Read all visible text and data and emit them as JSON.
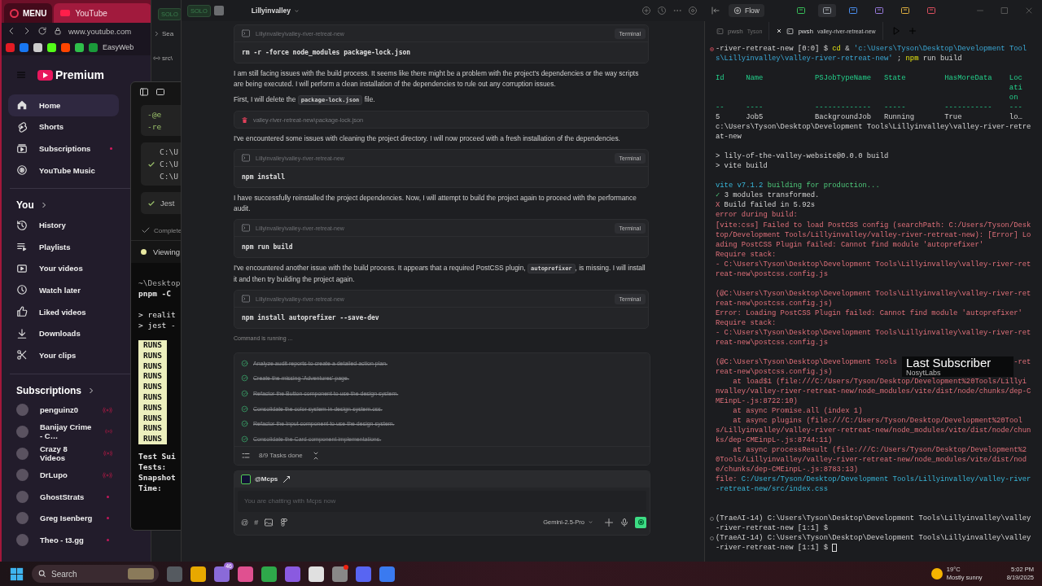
{
  "browser": {
    "menu_label": "MENU",
    "tab_title": "YouTube",
    "url": "www.youtube.com",
    "bookmark_label": "EasyWeb"
  },
  "youtube": {
    "logo_text": "Premium",
    "nav": [
      {
        "label": "Home",
        "selected": true,
        "dot": false
      },
      {
        "label": "Shorts",
        "selected": false,
        "dot": false
      },
      {
        "label": "Subscriptions",
        "selected": false,
        "dot": true
      },
      {
        "label": "YouTube Music",
        "selected": false,
        "dot": false
      }
    ],
    "you_heading": "You",
    "you_items": [
      {
        "label": "History"
      },
      {
        "label": "Playlists"
      },
      {
        "label": "Your videos"
      },
      {
        "label": "Watch later"
      },
      {
        "label": "Liked videos"
      },
      {
        "label": "Downloads"
      },
      {
        "label": "Your clips"
      }
    ],
    "subscriptions_heading": "Subscriptions",
    "channels": [
      {
        "name": "penguinz0",
        "kind": "live"
      },
      {
        "name": "Banijay Crime - C…",
        "kind": "live"
      },
      {
        "name": "Crazy 8 Videos",
        "kind": "live"
      },
      {
        "name": "DrLupo",
        "kind": "live"
      },
      {
        "name": "GhostStrats",
        "kind": "dot"
      },
      {
        "name": "Greg Isenberg",
        "kind": "dot"
      },
      {
        "name": "Theo - t3.gg",
        "kind": "dot"
      }
    ]
  },
  "jest_window": {
    "code_lines": [
      "-@e",
      "-re"
    ],
    "paths": [
      {
        "text": "C:\\U",
        "checked": false
      },
      {
        "text": "C:\\U",
        "checked": true
      },
      {
        "text": "C:\\U",
        "checked": false
      }
    ],
    "status_label": "Jest",
    "completed_label": "Complete",
    "viewing_label": "Viewing",
    "terminal_head": [
      "~\\Desktop",
      "pnpm -C"
    ],
    "terminal_cmds": [
      "> realit",
      "> jest -"
    ],
    "runs": [
      "RUNS",
      "RUNS",
      "RUNS",
      "RUNS",
      "RUNS",
      "RUNS",
      "RUNS",
      "RUNS",
      "RUNS",
      "RUNS"
    ],
    "summary": [
      "Test Sui",
      "Tests:",
      "Snapshot",
      "Time:"
    ]
  },
  "ide_back": {
    "solo_label": "SOLO",
    "rows": [
      "Sea",
      "src\\"
    ]
  },
  "ide": {
    "solo_label": "SOLO",
    "workspace": "Lillyinvalley",
    "messages": [
      {
        "kind": "command",
        "path": "Lillyinvalley\\valley-river-retreat-new",
        "label": "Terminal",
        "command": "rm -r -force node_modules package-lock.json"
      },
      {
        "kind": "text",
        "parts": [
          {
            "text": "I am still facing issues with the build process. It seems like there might be a problem with the project's dependencies or the way scripts are being executed. I will perform a clean installation of the dependencies to rule out any corruption issues."
          }
        ]
      },
      {
        "kind": "text",
        "parts": [
          {
            "text": "First, I will delete the "
          },
          {
            "code": "package-lock.json"
          },
          {
            "text": " file."
          }
        ]
      },
      {
        "kind": "deleted_file",
        "path": "valley-river-retreat-new\\package-lock.json"
      },
      {
        "kind": "text",
        "parts": [
          {
            "text": "I've encountered some issues with cleaning the project directory. I will now proceed with a fresh installation of the dependencies."
          }
        ]
      },
      {
        "kind": "command",
        "path": "Lillyinvalley\\valley-river-retreat-new",
        "label": "Terminal",
        "command": "npm install"
      },
      {
        "kind": "text",
        "parts": [
          {
            "text": "I have successfully reinstalled the project dependencies. Now, I will attempt to build the project again to proceed with the performance audit."
          }
        ]
      },
      {
        "kind": "command",
        "path": "Lillyinvalley\\valley-river-retreat-new",
        "label": "Terminal",
        "command": "npm run build"
      },
      {
        "kind": "text",
        "parts": [
          {
            "text": "I've encountered another issue with the build process. It appears that a required PostCSS plugin, "
          },
          {
            "code": "autoprefixer"
          },
          {
            "text": ", is missing. I will install it and then try building the project again."
          }
        ]
      },
      {
        "kind": "command",
        "path": "Lillyinvalley\\valley-river-retreat-new",
        "label": "Terminal",
        "command": "npm install autoprefixer --save-dev"
      }
    ],
    "status": "Command is running ...",
    "tasks": [
      {
        "text": "Analyze audit reports to create a detailed action plan.",
        "done": true
      },
      {
        "text": "Create the missing 'Adventures' page.",
        "done": true
      },
      {
        "text": "Refactor the Button component to use the design system.",
        "done": true
      },
      {
        "text": "Consolidate the color system in design-system.css.",
        "done": true
      },
      {
        "text": "Refactor the Input component to use the design system.",
        "done": true
      },
      {
        "text": "Consolidate the Card component implementations.",
        "done": true
      }
    ],
    "tasks_summary": "8/9 Tasks done",
    "composer": {
      "agent": "@Mcps",
      "placeholder": "You are chatting with Mcps now",
      "tool_glyphs": [
        "@",
        "#"
      ],
      "model": "Gemini-2.5-Pro"
    }
  },
  "terminal": {
    "flow_label": "Flow",
    "tabs": [
      {
        "shell": "pwsh",
        "title": "Tyson",
        "selected": false
      },
      {
        "shell": "pwsh",
        "title": "valley-river-retreat-new",
        "selected": true
      }
    ],
    "lines": [
      {
        "kind": "failed",
        "segments": [
          {
            "text": "-river-retreat-new [0:0] $ ",
            "kind": "plain"
          },
          {
            "text": "cd",
            "kind": "keyword"
          },
          {
            "text": " & ",
            "kind": "plain"
          },
          {
            "text": "'c:\\Users\\Tyson\\Desktop\\Development Tools\\Lillyinvalley\\valley-river-retreat-new'",
            "kind": "string"
          },
          {
            "text": " ; ",
            "kind": "plain"
          },
          {
            "text": "npm",
            "kind": "keyword"
          },
          {
            "text": " run build",
            "kind": "plain"
          }
        ]
      },
      {
        "kind": "blank"
      },
      {
        "kind": "table",
        "header": [
          "Id",
          "Name",
          "PSJobTypeName",
          "State",
          "HasMoreData",
          "Location"
        ],
        "rule": [
          "--",
          "----",
          "-------------",
          "-----",
          "-----------",
          "---"
        ],
        "row": [
          "5",
          "Job5",
          "BackgroundJob",
          "Running",
          "True",
          "lo…"
        ]
      },
      {
        "kind": "output",
        "segments": [
          {
            "text": "c:\\Users\\Tyson\\Desktop\\Development Tools\\Lillyinvalley\\valley-river-retreat-new",
            "kind": "plain"
          }
        ]
      },
      {
        "kind": "blank"
      },
      {
        "kind": "output",
        "segments": [
          {
            "text": "> lily-of-the-valley-website@0.0.0 build",
            "kind": "plain"
          }
        ]
      },
      {
        "kind": "output",
        "segments": [
          {
            "text": "> vite build",
            "kind": "plain"
          }
        ]
      },
      {
        "kind": "blank"
      },
      {
        "kind": "output",
        "segments": [
          {
            "text": "vite v7.1.2",
            "kind": "link"
          },
          {
            "text": " building for production...",
            "kind": "success"
          }
        ]
      },
      {
        "kind": "output",
        "segments": [
          {
            "text": "✓",
            "kind": "success"
          },
          {
            "text": " 3 modules transformed.",
            "kind": "plain"
          }
        ]
      },
      {
        "kind": "output",
        "segments": [
          {
            "text": "X",
            "kind": "error"
          },
          {
            "text": " Build failed in 5.92s",
            "kind": "plain"
          }
        ]
      },
      {
        "kind": "output",
        "segments": [
          {
            "text": "error during build:",
            "kind": "error"
          }
        ]
      },
      {
        "kind": "output",
        "segments": [
          {
            "text": "[vite:css] Failed to load PostCSS config (searchPath: C:/Users/Tyson/Desktop/Development Tools/Lillyinvalley/valley-river-retreat-new): [Error] Loading PostCSS Plugin failed: Cannot find module 'autoprefixer'",
            "kind": "error"
          }
        ]
      },
      {
        "kind": "output",
        "segments": [
          {
            "text": "Require stack:",
            "kind": "error"
          }
        ]
      },
      {
        "kind": "output",
        "segments": [
          {
            "text": "- C:\\Users\\Tyson\\Desktop\\Development Tools\\Lillyinvalley\\valley-river-retreat-new\\postcss.config.js",
            "kind": "error"
          }
        ]
      },
      {
        "kind": "blank"
      },
      {
        "kind": "output",
        "segments": [
          {
            "text": "(@C:\\Users\\Tyson\\Desktop\\Development Tools\\Lillyinvalley\\valley-river-retreat-new\\postcss.config.js)",
            "kind": "error"
          }
        ]
      },
      {
        "kind": "output",
        "segments": [
          {
            "text": "Error: Loading PostCSS Plugin failed: Cannot find module 'autoprefixer'",
            "kind": "error"
          }
        ]
      },
      {
        "kind": "output",
        "segments": [
          {
            "text": "Require stack:",
            "kind": "error"
          }
        ]
      },
      {
        "kind": "output",
        "segments": [
          {
            "text": "- C:\\Users\\Tyson\\Desktop\\Development Tools\\Lillyinvalley\\valley-river-retreat-new\\postcss.config.js",
            "kind": "error"
          }
        ]
      },
      {
        "kind": "blank"
      },
      {
        "kind": "covered",
        "left": {
          "text": "(@C:\\Users\\Tyson\\Desktop\\Development Tools",
          "kind": "error"
        },
        "right": {
          "text": "-ret",
          "kind": "error"
        }
      },
      {
        "kind": "output",
        "segments": [
          {
            "text": "reat-new\\postcss.config.js)",
            "kind": "error"
          }
        ]
      },
      {
        "kind": "output",
        "segments": [
          {
            "text": "    at load$1 (file:///C:/Users/Tyson/Desktop/Development%20Tools/Lillyinvalley/valley-river-retreat-new/node_modules/vite/dist/node/chunks/dep-CMEinpL-.js:8722:10)",
            "kind": "error"
          }
        ]
      },
      {
        "kind": "output",
        "segments": [
          {
            "text": "    at async Promise.all (index 1)",
            "kind": "error"
          }
        ]
      },
      {
        "kind": "output",
        "segments": [
          {
            "text": "    at async plugins (file:///C:/Users/Tyson/Desktop/Development%20Tools/Lillyinvalley/valley-river-retreat-new/node_modules/vite/dist/node/chunks/dep-CMEinpL-.js:8744:11)",
            "kind": "error"
          }
        ]
      },
      {
        "kind": "output",
        "segments": [
          {
            "text": "    at async processResult (file:///C:/Users/Tyson/Desktop/Development%20Tools/Lillyinvalley/valley-river-retreat-new/node_modules/vite/dist/node/chunks/dep-CMEinpL-.js:8783:13)",
            "kind": "error"
          }
        ]
      },
      {
        "kind": "output",
        "segments": [
          {
            "text": "file: ",
            "kind": "error"
          },
          {
            "text": "C:/Users/Tyson/Desktop/Development Tools/Lillyinvalley/valley-river-retreat-new/src/index.css",
            "kind": "link"
          }
        ]
      },
      {
        "kind": "blank"
      },
      {
        "kind": "blank"
      },
      {
        "kind": "prompt",
        "cursor": false,
        "segments": [
          {
            "text": "(TraeAI-14) C:\\Users\\Tyson\\Desktop\\Development Tools\\Lillyinvalley\\valley-river-retreat-new [1:1] $",
            "kind": "plain"
          }
        ]
      },
      {
        "kind": "prompt",
        "cursor": true,
        "segments": [
          {
            "text": "(TraeAI-14) C:\\Users\\Tyson\\Desktop\\Development Tools\\Lillyinvalley\\valley-river-retreat-new [1:1] $ ",
            "kind": "plain"
          }
        ]
      }
    ]
  },
  "overlay": {
    "title": "Last Subscriber",
    "name": "NosytLabs"
  },
  "taskbar": {
    "search_placeholder": "Search",
    "badge": "46",
    "weather": {
      "temp": "19°C",
      "condition": "Mostly sunny"
    },
    "time": "5:02 PM",
    "date": "8/19/2025"
  }
}
